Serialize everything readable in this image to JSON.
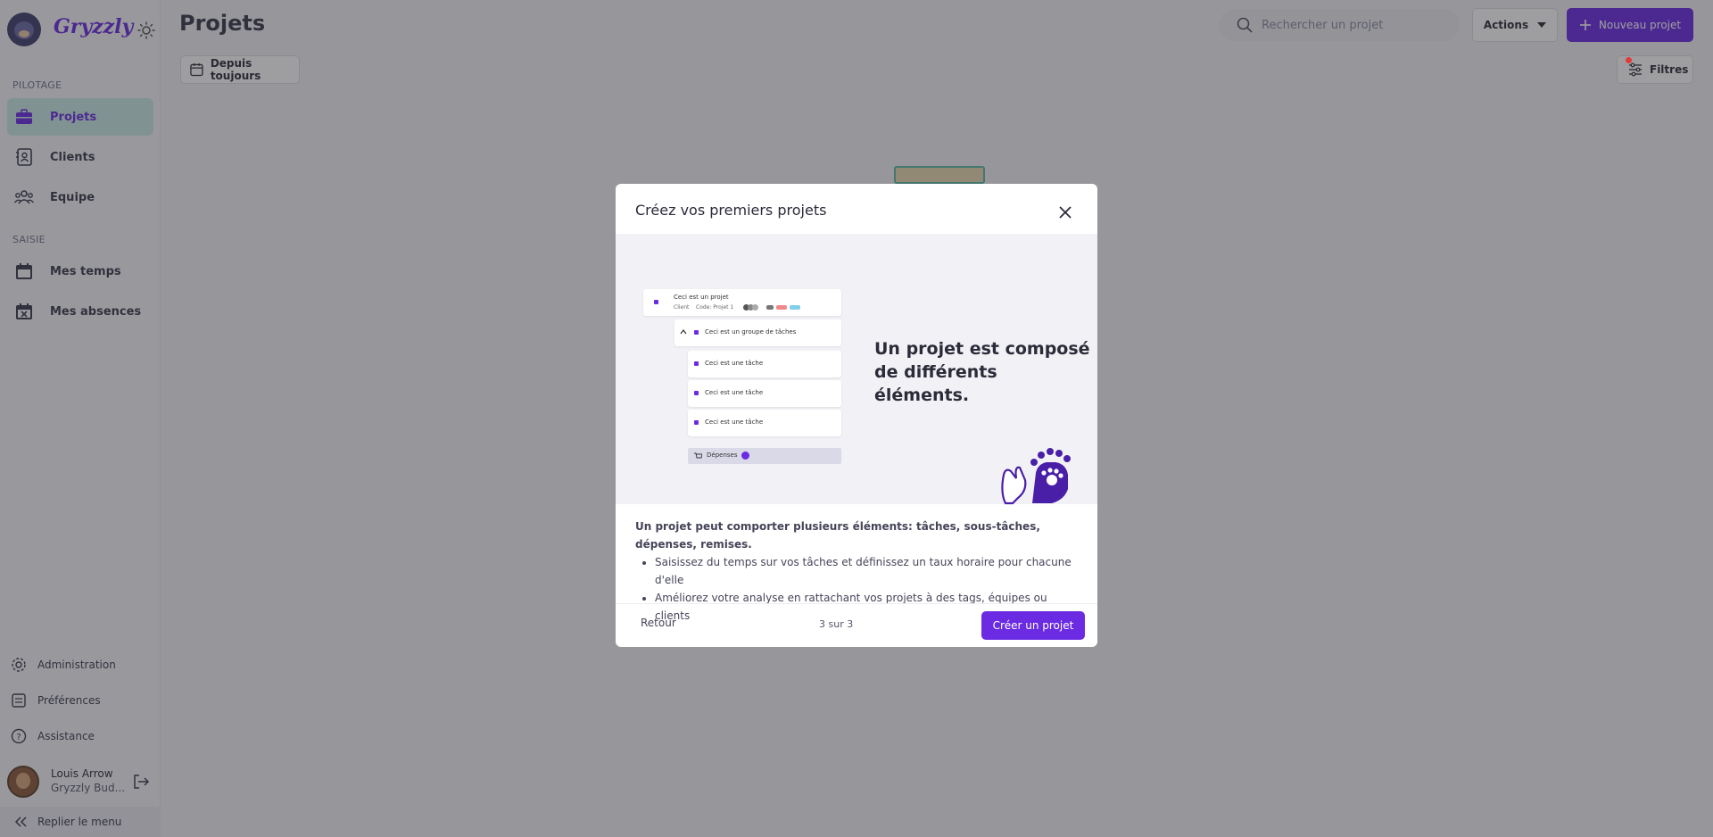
{
  "app": {
    "brand": "Gryzzly"
  },
  "sidebar": {
    "sections": {
      "pilotage": "PILOTAGE",
      "saisie": "SAISIE"
    },
    "items": [
      {
        "label": "Projets",
        "icon": "briefcase-icon",
        "active": true
      },
      {
        "label": "Clients",
        "icon": "contact-book-icon"
      },
      {
        "label": "Equipe",
        "icon": "team-icon"
      },
      {
        "label": "Mes temps",
        "icon": "calendar-icon"
      },
      {
        "label": "Mes absences",
        "icon": "calendar-x-icon"
      }
    ],
    "bottom": [
      {
        "label": "Administration",
        "icon": "gear-icon"
      },
      {
        "label": "Préférences",
        "icon": "preferences-icon"
      },
      {
        "label": "Assistance",
        "icon": "help-icon"
      }
    ],
    "user": {
      "name": "Louis Arrow",
      "org": "Gryzzly Bud..."
    },
    "collapse_label": "Replier le menu"
  },
  "header": {
    "title": "Projets",
    "search_placeholder": "Rechercher un projet",
    "actions_label": "Actions",
    "new_label": "Nouveau projet"
  },
  "filters": {
    "date_label": "Depuis toujours",
    "filters_label": "Filtres"
  },
  "modal": {
    "title": "Créez vos premiers projets",
    "illustration": {
      "project": "Ceci est un projet",
      "client": "Client",
      "code": "Code: Projet 1",
      "group": "Ceci est un groupe de tâches",
      "task": "Ceci est une tâche",
      "expenses": "Dépenses",
      "heading_line1": "Un projet est composé",
      "heading_line2": "de différents éléments."
    },
    "lead": "Un projet peut comporter plusieurs éléments: tâches, sous-tâches, dépenses, remises.",
    "bullets": [
      "Saisissez du temps sur vos tâches et définissez un taux horaire pour chacune d'elle",
      "Améliorez votre analyse en rattachant vos projets à des tags, équipes ou clients"
    ],
    "back_label": "Retour",
    "steps": "3 sur 3",
    "create_label": "Créer un projet"
  },
  "colors": {
    "accent": "#6b2be3",
    "active_bg": "#c9ece6"
  }
}
